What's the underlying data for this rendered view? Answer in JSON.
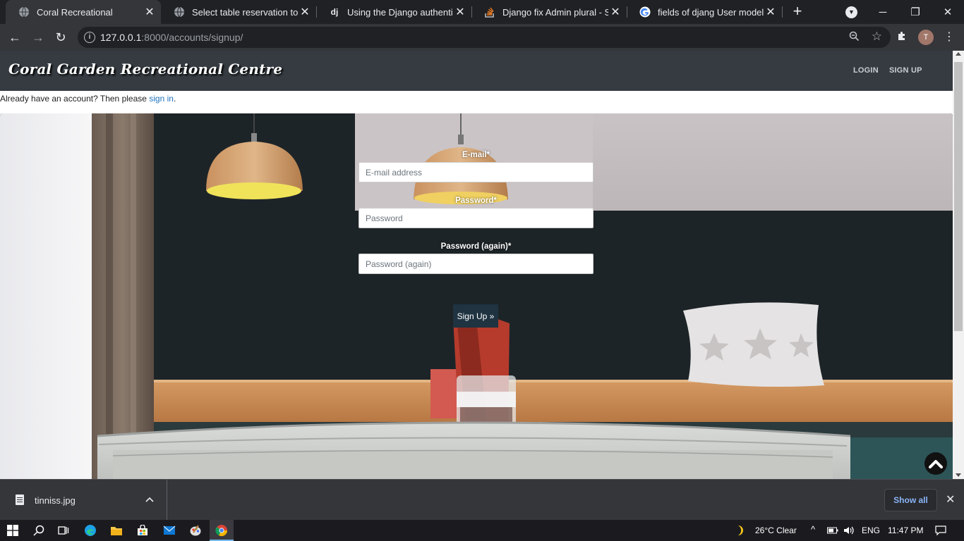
{
  "browser": {
    "tabs": [
      {
        "title": "Coral Recreational",
        "favicon": "globe-icon",
        "active": true
      },
      {
        "title": "Select table reservation to ch",
        "favicon": "globe-icon",
        "active": false
      },
      {
        "title": "Using the Django authenticat",
        "favicon": "django-icon",
        "active": false
      },
      {
        "title": "Django fix Admin plural - Sta",
        "favicon": "stackoverflow-icon",
        "active": false
      },
      {
        "title": "fields of djang User model - (",
        "favicon": "google-icon",
        "active": false
      }
    ],
    "django_favicon_text": "dj",
    "url_host": "127.0.0.1",
    "url_rest": ":8000/accounts/signup/",
    "profile_initial": "T"
  },
  "site": {
    "brand": "Coral Garden Recreational Centre",
    "nav": {
      "login": "LOGIN",
      "signup": "SIGN UP"
    },
    "already_text": "Already have an account? Then please ",
    "sign_in_link": "sign in",
    "already_suffix": "."
  },
  "form": {
    "email_label": "E-mail*",
    "email_placeholder": "E-mail address",
    "password_label": "Password*",
    "password_placeholder": "Password",
    "password2_label": "Password (again)*",
    "password2_placeholder": "Password (again)",
    "submit_label": "Sign Up »"
  },
  "downloads": {
    "file_name": "tinniss.jpg",
    "show_all": "Show all"
  },
  "taskbar": {
    "weather": "26°C  Clear",
    "lang": "ENG",
    "time": "11:47 PM"
  },
  "colors": {
    "navbar": "#353b41",
    "link": "#1e73be",
    "button": "#1f3341"
  }
}
